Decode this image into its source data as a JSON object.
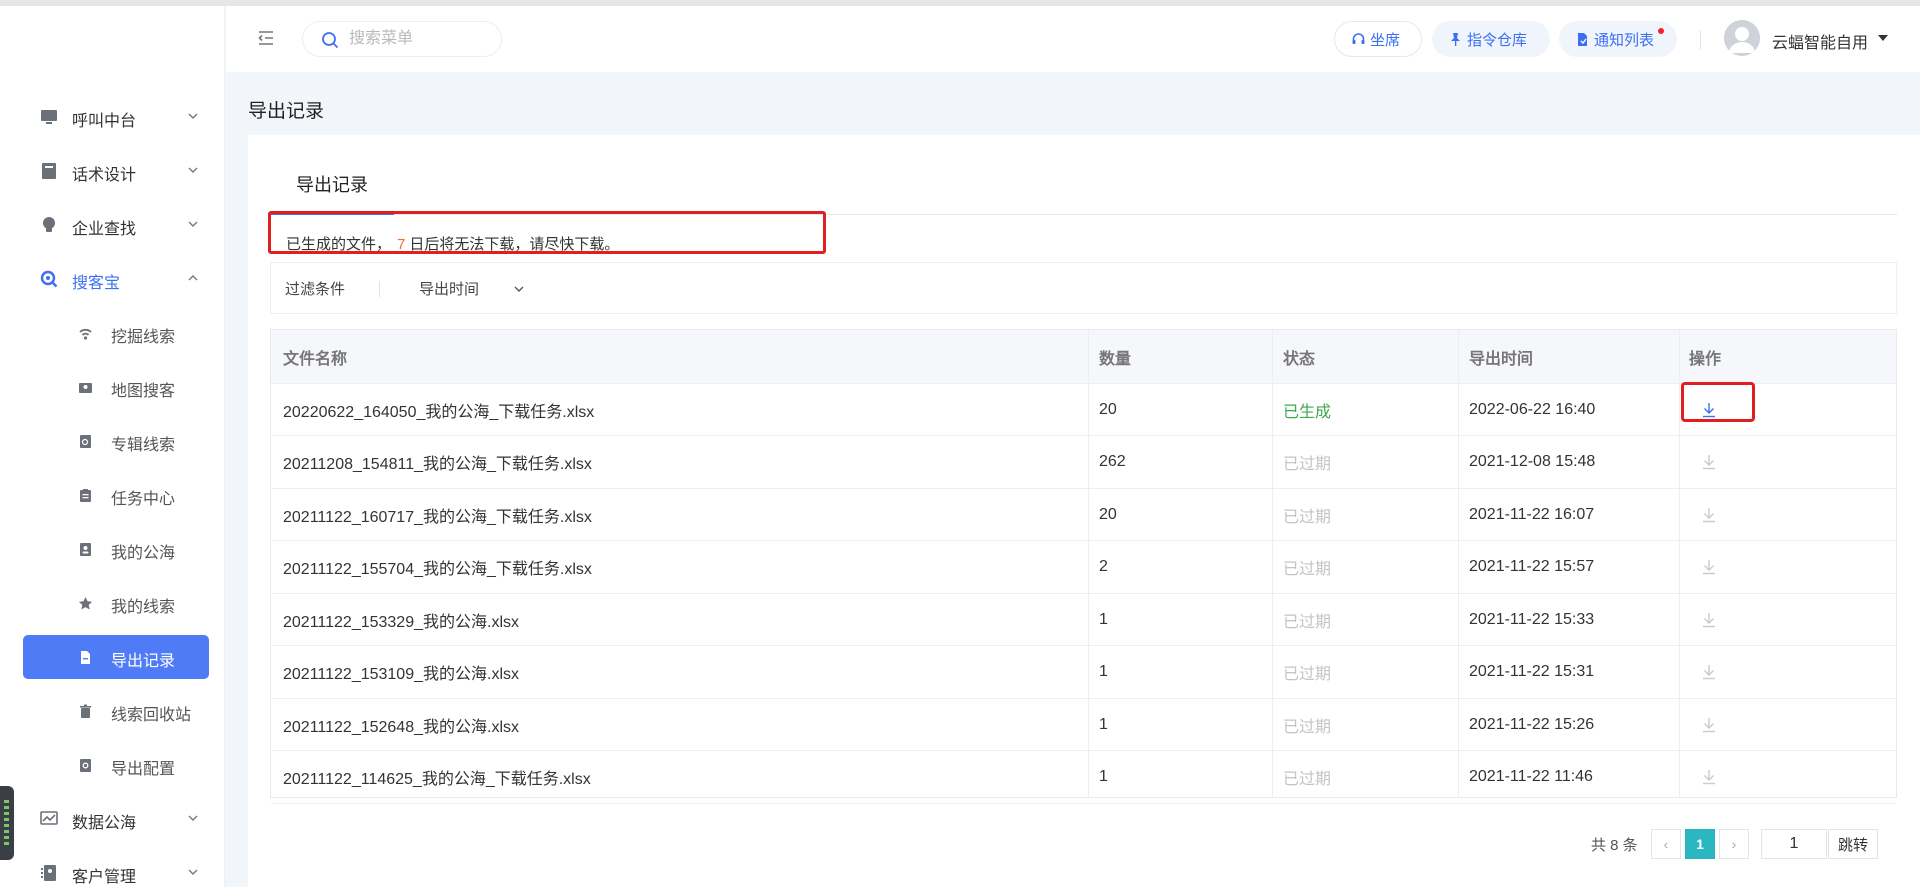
{
  "header": {
    "search_placeholder": "搜索菜单",
    "seat_label": "坐席",
    "command_label": "指令仓库",
    "notify_label": "通知列表",
    "user_name": "云蝠智能自用"
  },
  "sidebar": {
    "items": [
      {
        "label": "呼叫中台",
        "icon": "monitor-icon"
      },
      {
        "label": "话术设计",
        "icon": "book-icon"
      },
      {
        "label": "企业查找",
        "icon": "bulb-icon"
      },
      {
        "label": "搜客宝",
        "icon": "radar-search-icon"
      }
    ],
    "subitems": [
      {
        "label": "挖掘线索",
        "icon": "signal-icon"
      },
      {
        "label": "地图搜客",
        "icon": "map-pin-icon"
      },
      {
        "label": "专辑线索",
        "icon": "doc-search-icon"
      },
      {
        "label": "任务中心",
        "icon": "clipboard-icon"
      },
      {
        "label": "我的公海",
        "icon": "person-card-icon"
      },
      {
        "label": "我的线索",
        "icon": "star-icon"
      },
      {
        "label": "导出记录",
        "icon": "file-icon"
      },
      {
        "label": "线索回收站",
        "icon": "trash-icon"
      },
      {
        "label": "导出配置",
        "icon": "config-icon"
      }
    ],
    "bottom_items": [
      {
        "label": "数据公海",
        "icon": "chart-icon"
      },
      {
        "label": "客户管理",
        "icon": "contacts-icon"
      }
    ]
  },
  "page": {
    "title": "导出记录",
    "tab_title": "导出记录",
    "notice_prefix": "已生成的文件，",
    "notice_days": "7",
    "notice_suffix": "日后将无法下载，请尽快下载。",
    "filter_label": "过滤条件",
    "filter_dropdown": "导出时间"
  },
  "table": {
    "headers": [
      "文件名称",
      "数量",
      "状态",
      "导出时间",
      "操作"
    ],
    "rows": [
      {
        "name": "20220622_164050_我的公海_下载任务.xlsx",
        "count": "20",
        "status": "已生成",
        "time": "2022-06-22 16:40"
      },
      {
        "name": "20211208_154811_我的公海_下载任务.xlsx",
        "count": "262",
        "status": "已过期",
        "time": "2021-12-08 15:48"
      },
      {
        "name": "20211122_160717_我的公海_下载任务.xlsx",
        "count": "20",
        "status": "已过期",
        "time": "2021-11-22 16:07"
      },
      {
        "name": "20211122_155704_我的公海_下载任务.xlsx",
        "count": "2",
        "status": "已过期",
        "time": "2021-11-22 15:57"
      },
      {
        "name": "20211122_153329_我的公海.xlsx",
        "count": "1",
        "status": "已过期",
        "time": "2021-11-22 15:33"
      },
      {
        "name": "20211122_153109_我的公海.xlsx",
        "count": "1",
        "status": "已过期",
        "time": "2021-11-22 15:31"
      },
      {
        "name": "20211122_152648_我的公海.xlsx",
        "count": "1",
        "status": "已过期",
        "time": "2021-11-22 15:26"
      },
      {
        "name": "20211122_114625_我的公海_下载任务.xlsx",
        "count": "1",
        "status": "已过期",
        "time": "2021-11-22 11:46"
      }
    ]
  },
  "pagination": {
    "total": "共 8 条",
    "current": "1",
    "page_input": "1",
    "jump_label": "跳转",
    "prev": "‹",
    "next": "›"
  },
  "colors": {
    "accent": "#4f7bf7",
    "link": "#3d6ff5",
    "success": "#3fa84a",
    "muted": "#c2c4c8",
    "highlight": "#e02020",
    "pager_active": "#2ab7c2"
  }
}
